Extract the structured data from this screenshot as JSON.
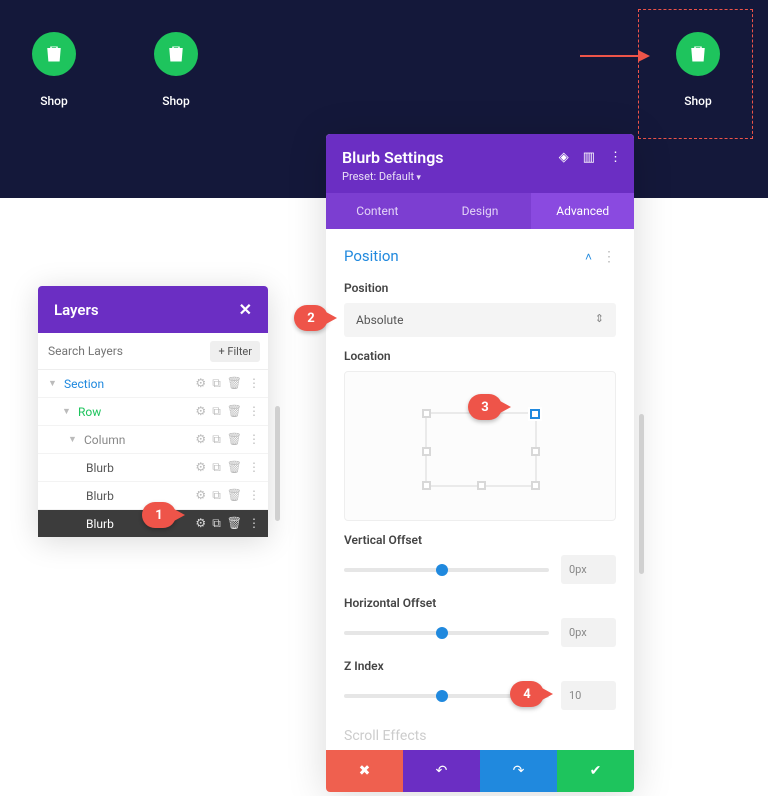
{
  "header": {
    "shop_label": "Shop"
  },
  "layers": {
    "title": "Layers",
    "search_placeholder": "Search Layers",
    "filter_label": "+ Filter",
    "tree": {
      "section": "Section",
      "row": "Row",
      "column": "Column",
      "blurb1": "Blurb",
      "blurb2": "Blurb",
      "blurb3": "Blurb"
    }
  },
  "settings": {
    "title": "Blurb Settings",
    "preset": "Preset: Default",
    "tabs": {
      "content": "Content",
      "design": "Design",
      "advanced": "Advanced"
    },
    "section_title": "Position",
    "position": {
      "label": "Position",
      "value": "Absolute"
    },
    "location": {
      "label": "Location"
    },
    "vertical_offset": {
      "label": "Vertical Offset",
      "value": "0px"
    },
    "horizontal_offset": {
      "label": "Horizontal Offset",
      "value": "0px"
    },
    "z_index": {
      "label": "Z Index",
      "value": "10"
    },
    "next_section": "Scroll Effects"
  },
  "callouts": {
    "c1": "1",
    "c2": "2",
    "c3": "3",
    "c4": "4"
  }
}
